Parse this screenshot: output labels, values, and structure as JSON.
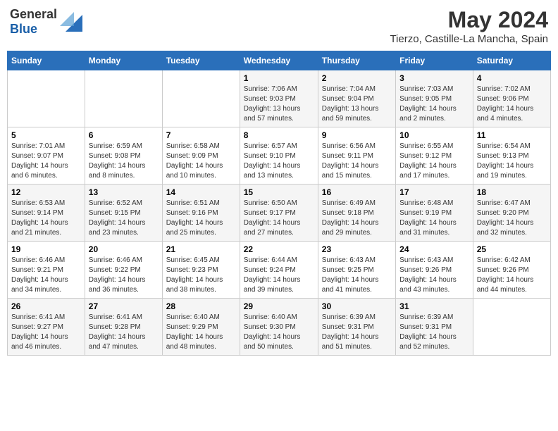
{
  "header": {
    "logo_general": "General",
    "logo_blue": "Blue",
    "main_title": "May 2024",
    "subtitle": "Tierzo, Castille-La Mancha, Spain"
  },
  "weekdays": [
    "Sunday",
    "Monday",
    "Tuesday",
    "Wednesday",
    "Thursday",
    "Friday",
    "Saturday"
  ],
  "rows": [
    [
      {
        "day": "",
        "sunrise": "",
        "sunset": "",
        "daylight": ""
      },
      {
        "day": "",
        "sunrise": "",
        "sunset": "",
        "daylight": ""
      },
      {
        "day": "",
        "sunrise": "",
        "sunset": "",
        "daylight": ""
      },
      {
        "day": "1",
        "sunrise": "Sunrise: 7:06 AM",
        "sunset": "Sunset: 9:03 PM",
        "daylight": "Daylight: 13 hours and 57 minutes."
      },
      {
        "day": "2",
        "sunrise": "Sunrise: 7:04 AM",
        "sunset": "Sunset: 9:04 PM",
        "daylight": "Daylight: 13 hours and 59 minutes."
      },
      {
        "day": "3",
        "sunrise": "Sunrise: 7:03 AM",
        "sunset": "Sunset: 9:05 PM",
        "daylight": "Daylight: 14 hours and 2 minutes."
      },
      {
        "day": "4",
        "sunrise": "Sunrise: 7:02 AM",
        "sunset": "Sunset: 9:06 PM",
        "daylight": "Daylight: 14 hours and 4 minutes."
      }
    ],
    [
      {
        "day": "5",
        "sunrise": "Sunrise: 7:01 AM",
        "sunset": "Sunset: 9:07 PM",
        "daylight": "Daylight: 14 hours and 6 minutes."
      },
      {
        "day": "6",
        "sunrise": "Sunrise: 6:59 AM",
        "sunset": "Sunset: 9:08 PM",
        "daylight": "Daylight: 14 hours and 8 minutes."
      },
      {
        "day": "7",
        "sunrise": "Sunrise: 6:58 AM",
        "sunset": "Sunset: 9:09 PM",
        "daylight": "Daylight: 14 hours and 10 minutes."
      },
      {
        "day": "8",
        "sunrise": "Sunrise: 6:57 AM",
        "sunset": "Sunset: 9:10 PM",
        "daylight": "Daylight: 14 hours and 13 minutes."
      },
      {
        "day": "9",
        "sunrise": "Sunrise: 6:56 AM",
        "sunset": "Sunset: 9:11 PM",
        "daylight": "Daylight: 14 hours and 15 minutes."
      },
      {
        "day": "10",
        "sunrise": "Sunrise: 6:55 AM",
        "sunset": "Sunset: 9:12 PM",
        "daylight": "Daylight: 14 hours and 17 minutes."
      },
      {
        "day": "11",
        "sunrise": "Sunrise: 6:54 AM",
        "sunset": "Sunset: 9:13 PM",
        "daylight": "Daylight: 14 hours and 19 minutes."
      }
    ],
    [
      {
        "day": "12",
        "sunrise": "Sunrise: 6:53 AM",
        "sunset": "Sunset: 9:14 PM",
        "daylight": "Daylight: 14 hours and 21 minutes."
      },
      {
        "day": "13",
        "sunrise": "Sunrise: 6:52 AM",
        "sunset": "Sunset: 9:15 PM",
        "daylight": "Daylight: 14 hours and 23 minutes."
      },
      {
        "day": "14",
        "sunrise": "Sunrise: 6:51 AM",
        "sunset": "Sunset: 9:16 PM",
        "daylight": "Daylight: 14 hours and 25 minutes."
      },
      {
        "day": "15",
        "sunrise": "Sunrise: 6:50 AM",
        "sunset": "Sunset: 9:17 PM",
        "daylight": "Daylight: 14 hours and 27 minutes."
      },
      {
        "day": "16",
        "sunrise": "Sunrise: 6:49 AM",
        "sunset": "Sunset: 9:18 PM",
        "daylight": "Daylight: 14 hours and 29 minutes."
      },
      {
        "day": "17",
        "sunrise": "Sunrise: 6:48 AM",
        "sunset": "Sunset: 9:19 PM",
        "daylight": "Daylight: 14 hours and 31 minutes."
      },
      {
        "day": "18",
        "sunrise": "Sunrise: 6:47 AM",
        "sunset": "Sunset: 9:20 PM",
        "daylight": "Daylight: 14 hours and 32 minutes."
      }
    ],
    [
      {
        "day": "19",
        "sunrise": "Sunrise: 6:46 AM",
        "sunset": "Sunset: 9:21 PM",
        "daylight": "Daylight: 14 hours and 34 minutes."
      },
      {
        "day": "20",
        "sunrise": "Sunrise: 6:46 AM",
        "sunset": "Sunset: 9:22 PM",
        "daylight": "Daylight: 14 hours and 36 minutes."
      },
      {
        "day": "21",
        "sunrise": "Sunrise: 6:45 AM",
        "sunset": "Sunset: 9:23 PM",
        "daylight": "Daylight: 14 hours and 38 minutes."
      },
      {
        "day": "22",
        "sunrise": "Sunrise: 6:44 AM",
        "sunset": "Sunset: 9:24 PM",
        "daylight": "Daylight: 14 hours and 39 minutes."
      },
      {
        "day": "23",
        "sunrise": "Sunrise: 6:43 AM",
        "sunset": "Sunset: 9:25 PM",
        "daylight": "Daylight: 14 hours and 41 minutes."
      },
      {
        "day": "24",
        "sunrise": "Sunrise: 6:43 AM",
        "sunset": "Sunset: 9:26 PM",
        "daylight": "Daylight: 14 hours and 43 minutes."
      },
      {
        "day": "25",
        "sunrise": "Sunrise: 6:42 AM",
        "sunset": "Sunset: 9:26 PM",
        "daylight": "Daylight: 14 hours and 44 minutes."
      }
    ],
    [
      {
        "day": "26",
        "sunrise": "Sunrise: 6:41 AM",
        "sunset": "Sunset: 9:27 PM",
        "daylight": "Daylight: 14 hours and 46 minutes."
      },
      {
        "day": "27",
        "sunrise": "Sunrise: 6:41 AM",
        "sunset": "Sunset: 9:28 PM",
        "daylight": "Daylight: 14 hours and 47 minutes."
      },
      {
        "day": "28",
        "sunrise": "Sunrise: 6:40 AM",
        "sunset": "Sunset: 9:29 PM",
        "daylight": "Daylight: 14 hours and 48 minutes."
      },
      {
        "day": "29",
        "sunrise": "Sunrise: 6:40 AM",
        "sunset": "Sunset: 9:30 PM",
        "daylight": "Daylight: 14 hours and 50 minutes."
      },
      {
        "day": "30",
        "sunrise": "Sunrise: 6:39 AM",
        "sunset": "Sunset: 9:31 PM",
        "daylight": "Daylight: 14 hours and 51 minutes."
      },
      {
        "day": "31",
        "sunrise": "Sunrise: 6:39 AM",
        "sunset": "Sunset: 9:31 PM",
        "daylight": "Daylight: 14 hours and 52 minutes."
      },
      {
        "day": "",
        "sunrise": "",
        "sunset": "",
        "daylight": ""
      }
    ]
  ]
}
